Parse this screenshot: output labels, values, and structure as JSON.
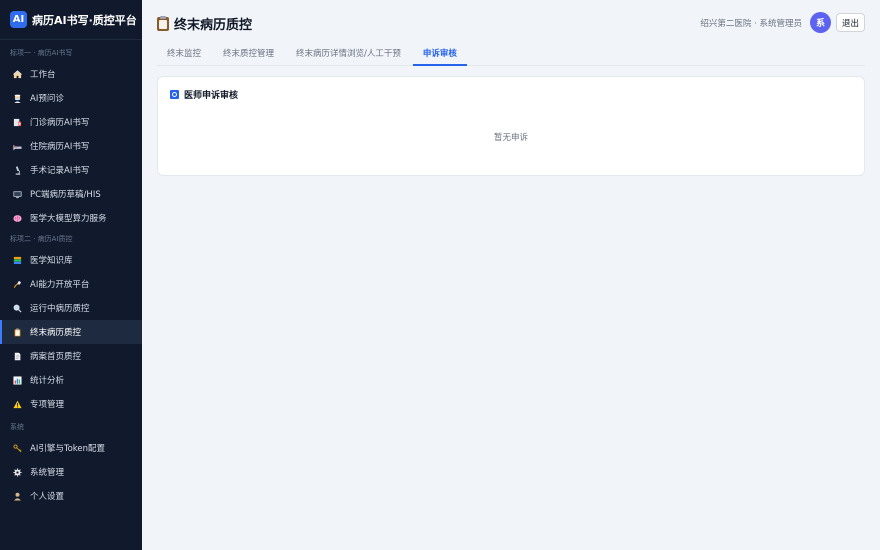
{
  "brand": {
    "logo": "AI",
    "title": "病历AI书写·质控平台",
    "accent": "#2f6cf0"
  },
  "sidebar": {
    "section1": "标项一 · 病历AI书写",
    "group1": [
      {
        "label": "工作台",
        "icon": "home-icon"
      },
      {
        "label": "AI预问诊",
        "icon": "doctor-icon"
      },
      {
        "label": "门诊病历AI书写",
        "icon": "clinic-icon"
      },
      {
        "label": "住院病历AI书写",
        "icon": "bed-icon"
      },
      {
        "label": "手术记录AI书写",
        "icon": "microscope-icon"
      },
      {
        "label": "PC端病历草稿/HIS",
        "icon": "monitor-icon"
      },
      {
        "label": "医学大模型算力服务",
        "icon": "brain-icon"
      }
    ],
    "section2": "标项二 · 病历AI质控",
    "group2": [
      {
        "label": "医学知识库",
        "icon": "books-icon"
      },
      {
        "label": "AI能力开放平台",
        "icon": "plug-icon"
      },
      {
        "label": "运行中病历质控",
        "icon": "magnifier-icon"
      },
      {
        "label": "终末病历质控",
        "icon": "clipboard-icon"
      },
      {
        "label": "病案首页质控",
        "icon": "document-icon"
      },
      {
        "label": "统计分析",
        "icon": "bar-chart-icon"
      },
      {
        "label": "专项管理",
        "icon": "warning-icon"
      }
    ],
    "section3": "系统",
    "group3": [
      {
        "label": "AI引擎与Token配置",
        "icon": "key-icon"
      },
      {
        "label": "系统管理",
        "icon": "gear-icon"
      },
      {
        "label": "个人设置",
        "icon": "user-icon"
      }
    ],
    "active_label": "终末病历质控"
  },
  "header": {
    "title": "终末病历质控",
    "user_meta": "绍兴第二医院 · 系统管理员",
    "avatar_text": "系",
    "logout_label": "退出"
  },
  "tabs": [
    {
      "label": "终末监控",
      "active": false
    },
    {
      "label": "终末质控管理",
      "active": false
    },
    {
      "label": "终末病历详情浏览/人工干预",
      "active": false
    },
    {
      "label": "申诉审核",
      "active": true
    }
  ],
  "card": {
    "title": "医师申诉审核",
    "empty_text": "暂无申诉"
  }
}
